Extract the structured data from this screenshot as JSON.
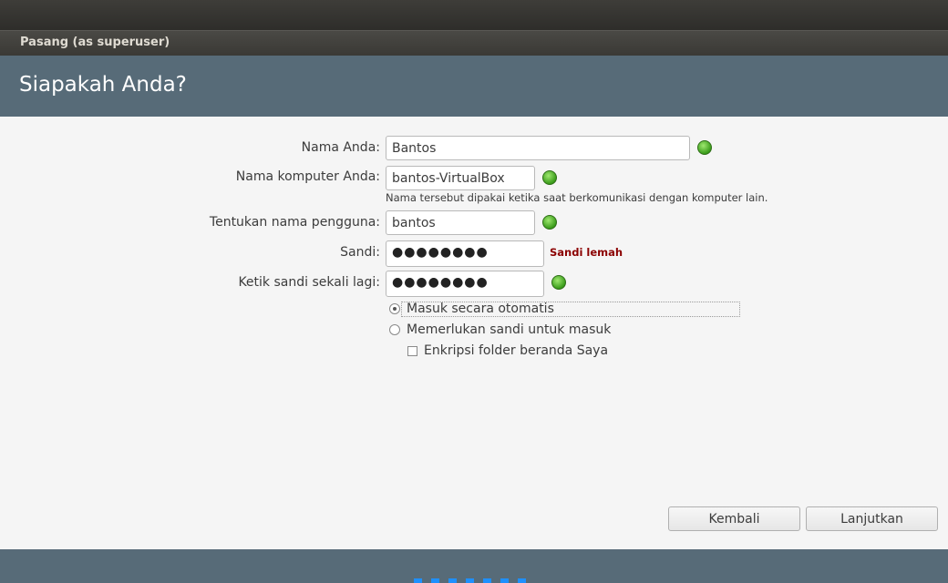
{
  "window": {
    "title": "Pasang (as superuser)"
  },
  "header": {
    "heading": "Siapakah Anda?"
  },
  "form": {
    "name": {
      "label": "Nama Anda:",
      "value": "Bantos"
    },
    "computer": {
      "label": "Nama komputer Anda:",
      "value": "bantos-VirtualBox",
      "hint": "Nama tersebut dipakai ketika saat berkomunikasi dengan komputer lain."
    },
    "username": {
      "label": "Tentukan nama pengguna:",
      "value": "bantos"
    },
    "password": {
      "label": "Sandi:",
      "value": "●●●●●●●●",
      "strength": "Sandi lemah"
    },
    "confirm": {
      "label": "Ketik sandi sekali lagi:",
      "value": "●●●●●●●●"
    },
    "login_options": {
      "auto": {
        "label": "Masuk secara otomatis",
        "selected": true
      },
      "require": {
        "label": "Memerlukan sandi untuk masuk",
        "selected": false
      },
      "encrypt": {
        "label": "Enkripsi folder beranda Saya",
        "checked": false
      }
    }
  },
  "buttons": {
    "back": "Kembali",
    "next": "Lanjutkan"
  },
  "footer": {
    "progress_steps": 7
  },
  "colors": {
    "header": "#576b78",
    "ok": "#3a9c1a",
    "weak": "#8b0000"
  },
  "icons": {
    "valid": "green-check-dot-icon"
  }
}
